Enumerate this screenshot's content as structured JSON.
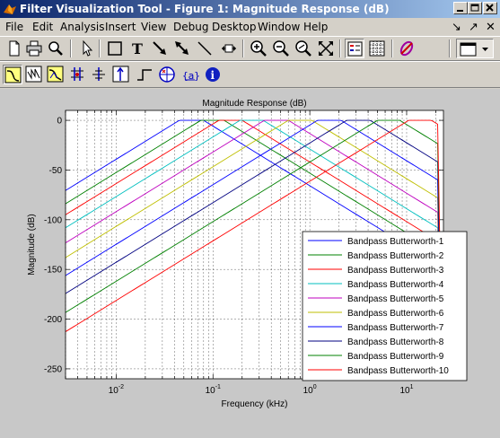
{
  "window": {
    "title": "Filter Visualization Tool - Figure 1: Magnitude Response (dB)"
  },
  "menus": [
    "File",
    "Edit",
    "Analysis",
    "Insert",
    "View",
    "Debug",
    "Desktop",
    "Window",
    "Help"
  ],
  "menu_right_icons": [
    "↘",
    "↗",
    "✕"
  ],
  "toolbar1": [
    {
      "name": "new-figure-icon"
    },
    {
      "name": "print-icon"
    },
    {
      "name": "zoom-tool-icon"
    },
    {
      "name": "select-arrow-icon"
    },
    {
      "name": "insert-rectangle-icon"
    },
    {
      "name": "insert-text-icon"
    },
    {
      "name": "insert-arrow-icon"
    },
    {
      "name": "insert-double-arrow-icon"
    },
    {
      "name": "insert-line-icon"
    },
    {
      "name": "pan-tool-icon"
    },
    {
      "name": "zoom-in-icon"
    },
    {
      "name": "zoom-out-icon"
    },
    {
      "name": "zoom-x-icon"
    },
    {
      "name": "full-view-icon"
    },
    {
      "name": "legend-toggle-icon"
    },
    {
      "name": "grid-toggle-icon"
    },
    {
      "name": "link-to-fdatool-icon"
    },
    {
      "name": "new-window-icon"
    }
  ],
  "toolbar2": [
    {
      "name": "magnitude-response-icon"
    },
    {
      "name": "phase-response-icon"
    },
    {
      "name": "magnitude-phase-icon"
    },
    {
      "name": "group-delay-icon"
    },
    {
      "name": "phase-delay-icon"
    },
    {
      "name": "impulse-response-icon"
    },
    {
      "name": "step-response-icon"
    },
    {
      "name": "pole-zero-icon"
    },
    {
      "name": "filter-coefficients-icon"
    },
    {
      "name": "filter-info-icon"
    }
  ],
  "colors": {
    "series": [
      "#0000ff",
      "#008000",
      "#ff0000",
      "#00bfbf",
      "#bf00bf",
      "#bfbf00",
      "#0000ff",
      "#000080",
      "#008000",
      "#ff0000"
    ],
    "title_bar_start": "#0a246a",
    "title_bar_end": "#a6caf0",
    "window_bg": "#d4d0c8",
    "figure_bg": "#c8c8c8"
  },
  "chart_data": {
    "type": "line",
    "title": "Magnitude Response (dB)",
    "xlabel": "Frequency (kHz)",
    "ylabel": "Magnitude (dB)",
    "xscale": "log",
    "xlim": [
      0.003,
      24
    ],
    "ylim": [
      -260,
      10
    ],
    "yticks": [
      0,
      -50,
      -100,
      -150,
      -200,
      -250
    ],
    "yticklabels": [
      "0",
      "-50",
      "-100",
      "-150",
      "-200",
      "-250"
    ],
    "xticks": [
      0.01,
      0.1,
      1,
      10
    ],
    "xticklabels": [
      "10-2",
      "10-1",
      "100",
      "101"
    ],
    "grid": true,
    "legend_position": "bottom-right",
    "series": [
      {
        "name": "Bandpass Butterworth-1",
        "center_khz": 0.06,
        "low_khz": 0.045,
        "high_khz": 0.08
      },
      {
        "name": "Bandpass Butterworth-2",
        "center_khz": 0.1,
        "low_khz": 0.075,
        "high_khz": 0.13
      },
      {
        "name": "Bandpass Butterworth-3",
        "center_khz": 0.15,
        "low_khz": 0.115,
        "high_khz": 0.2
      },
      {
        "name": "Bandpass Butterworth-4",
        "center_khz": 0.25,
        "low_khz": 0.19,
        "high_khz": 0.33
      },
      {
        "name": "Bandpass Butterworth-5",
        "center_khz": 0.45,
        "low_khz": 0.34,
        "high_khz": 0.6
      },
      {
        "name": "Bandpass Butterworth-6",
        "center_khz": 0.8,
        "low_khz": 0.6,
        "high_khz": 1.05
      },
      {
        "name": "Bandpass Butterworth-7",
        "center_khz": 1.6,
        "low_khz": 1.2,
        "high_khz": 2.1
      },
      {
        "name": "Bandpass Butterworth-8",
        "center_khz": 3.2,
        "low_khz": 2.4,
        "high_khz": 4.2
      },
      {
        "name": "Bandpass Butterworth-9",
        "center_khz": 6.5,
        "low_khz": 5,
        "high_khz": 8.5
      },
      {
        "name": "Bandpass Butterworth-10",
        "center_khz": 14,
        "low_khz": 10.5,
        "high_khz": 18
      }
    ],
    "rolloff_db_per_decade": 60
  }
}
